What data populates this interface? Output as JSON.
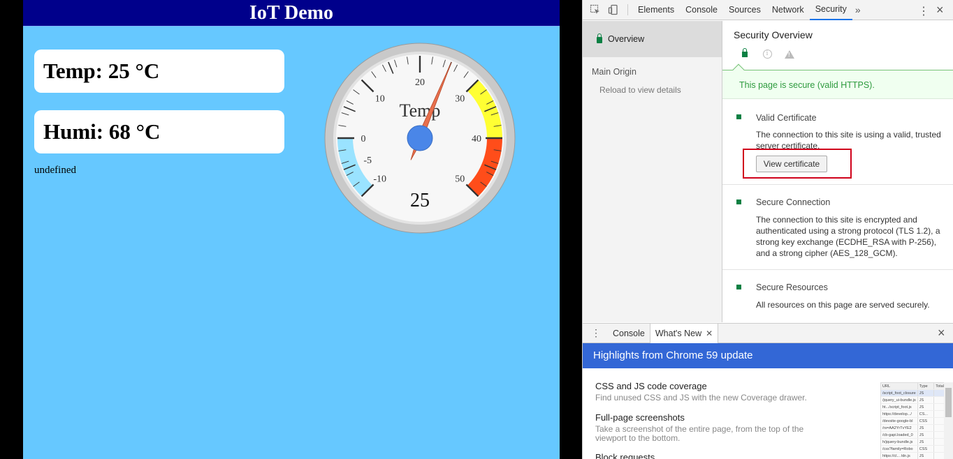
{
  "page": {
    "header": "IoT Demo",
    "temp_card": "Temp: 25 °C",
    "humi_card": "Humi: 68 °C",
    "status_text": "undefined",
    "gauge": {
      "label": "Temp",
      "value": 25,
      "value_text": "25",
      "min": -10,
      "max": 50,
      "tick_labels": [
        "-10",
        "-5",
        "0",
        "10",
        "20",
        "30",
        "40",
        "50"
      ],
      "zones": [
        {
          "from": -10,
          "to": 0,
          "color": "#9ae3ff"
        },
        {
          "from": 30,
          "to": 40,
          "color": "#ffff33"
        },
        {
          "from": 40,
          "to": 50,
          "color": "#ff4d1a"
        }
      ]
    }
  },
  "devtools": {
    "tabs": [
      "Elements",
      "Console",
      "Sources",
      "Network",
      "Security"
    ],
    "active_tab": "Security",
    "more_tabs": "»",
    "sidebar": {
      "overview": "Overview",
      "main_origin": "Main Origin",
      "reload": "Reload to view details"
    },
    "security": {
      "title": "Security Overview",
      "banner": "This page is secure (valid HTTPS).",
      "sections": [
        {
          "heading": "Valid Certificate",
          "description": "The connection to this site is using a valid, trusted server certificate.",
          "button": "View certificate"
        },
        {
          "heading": "Secure Connection",
          "description": "The connection to this site is encrypted and authenticated using a strong protocol (TLS 1.2), a strong key exchange (ECDHE_RSA with P-256), and a strong cipher (AES_128_GCM)."
        },
        {
          "heading": "Secure Resources",
          "description": "All resources on this page are served securely."
        }
      ]
    },
    "drawer": {
      "tabs": [
        "Console",
        "What's New"
      ],
      "highlight": "Highlights from Chrome 59 update",
      "items": [
        {
          "title": "CSS and JS code coverage",
          "desc": "Find unused CSS and JS with the new Coverage drawer."
        },
        {
          "title": "Full-page screenshots",
          "desc": "Take a screenshot of the entire page, from the top of the viewport to the bottom."
        },
        {
          "title": "Block requests",
          "desc": ""
        }
      ],
      "thumbnail": {
        "headers": [
          "URL",
          "Type",
          "Total"
        ],
        "rows": [
          [
            "/script_foot_closure",
            "JS"
          ],
          [
            "/jquery_ui-bundle.js",
            "JS"
          ],
          [
            "ht.../script_foot.js",
            "JS"
          ],
          [
            "https://develop.../",
            "CS..."
          ],
          [
            "/devsite-google-bl",
            "CSS"
          ],
          [
            "/rs=AA2YrTvYE2",
            "JS"
          ],
          [
            "/cb-gapi.loaded_0",
            "JS"
          ],
          [
            "h/jquery-bundle.js",
            "JS"
          ],
          [
            "/css?family=Robo",
            "CSS"
          ],
          [
            "https://cl... /dn.js",
            "JS"
          ]
        ]
      }
    },
    "colors": {
      "secure_green": "#0b8043",
      "highlight_red": "#d0021b",
      "drawer_blue": "#3367d6"
    }
  }
}
